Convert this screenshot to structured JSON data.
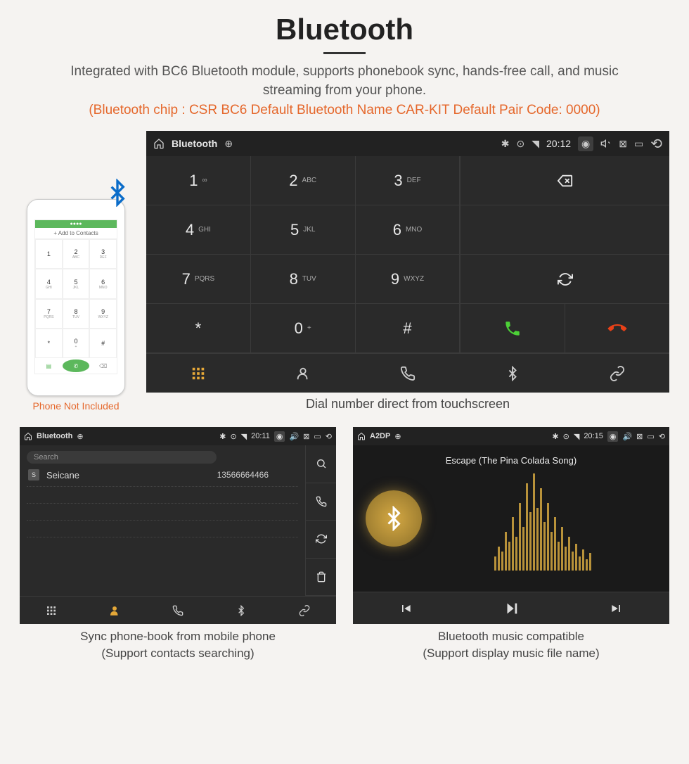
{
  "title": "Bluetooth",
  "subtitle": "Integrated with BC6 Bluetooth module, supports phonebook sync, hands-free call, and music streaming from your phone.",
  "specs": "(Bluetooth chip : CSR BC6     Default Bluetooth Name CAR-KIT     Default Pair Code: 0000)",
  "phone": {
    "add_contacts": "Add to Contacts",
    "caption": "Phone Not Included"
  },
  "dialer": {
    "status": {
      "title": "Bluetooth",
      "time": "20:12"
    },
    "keys": [
      {
        "n": "1",
        "s": "∞"
      },
      {
        "n": "2",
        "s": "ABC"
      },
      {
        "n": "3",
        "s": "DEF"
      },
      {
        "n": "4",
        "s": "GHI"
      },
      {
        "n": "5",
        "s": "JKL"
      },
      {
        "n": "6",
        "s": "MNO"
      },
      {
        "n": "7",
        "s": "PQRS"
      },
      {
        "n": "8",
        "s": "TUV"
      },
      {
        "n": "9",
        "s": "WXYZ"
      },
      {
        "n": "*",
        "s": ""
      },
      {
        "n": "0",
        "s": "+"
      },
      {
        "n": "#",
        "s": ""
      }
    ],
    "caption": "Dial number direct from touchscreen"
  },
  "contacts": {
    "status": {
      "title": "Bluetooth",
      "time": "20:11"
    },
    "search_placeholder": "Search",
    "rows": [
      {
        "initial": "S",
        "name": "Seicane",
        "number": "13566664466"
      }
    ],
    "caption_l1": "Sync phone-book from mobile phone",
    "caption_l2": "(Support contacts searching)"
  },
  "music": {
    "status": {
      "title": "A2DP",
      "time": "20:15"
    },
    "track": "Escape (The Pina Colada Song)",
    "caption_l1": "Bluetooth music compatible",
    "caption_l2": "(Support display music file name)"
  }
}
